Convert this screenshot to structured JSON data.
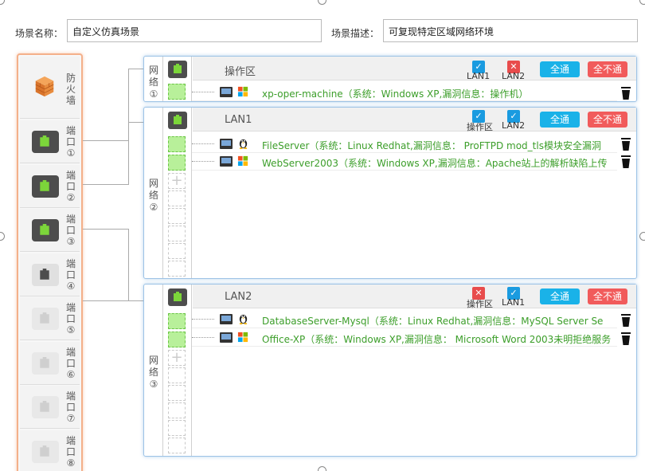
{
  "scene": {
    "name_label": "场景名称：",
    "name_value": "自定义仿真场景",
    "desc_label": "场景描述：",
    "desc_value": "可复现特定区域网络环境"
  },
  "firewall": {
    "label": "防火墙",
    "ports": [
      {
        "label": "端口①",
        "state": "active"
      },
      {
        "label": "端口②",
        "state": "active"
      },
      {
        "label": "端口③",
        "state": "active"
      },
      {
        "label": "端口④",
        "state": "idle"
      },
      {
        "label": "端口⑤",
        "state": "disabled"
      },
      {
        "label": "端口⑥",
        "state": "disabled"
      },
      {
        "label": "端口⑦",
        "state": "disabled"
      },
      {
        "label": "端口⑧",
        "state": "disabled"
      }
    ]
  },
  "networks": [
    {
      "label": "网络①",
      "title": "操作区",
      "checks": [
        {
          "label": "LAN1",
          "checked": true
        },
        {
          "label": "LAN2",
          "checked": false
        }
      ],
      "all_button": "全通",
      "none_button": "全不通",
      "hosts": [
        {
          "text": "xp-oper-machine（系统：Windows XP,漏洞信息：操作机）",
          "os": "windows-icon"
        }
      ]
    },
    {
      "label": "网络②",
      "title": "LAN1",
      "checks": [
        {
          "label": "操作区",
          "checked": true
        },
        {
          "label": "LAN2",
          "checked": true
        }
      ],
      "all_button": "全通",
      "none_button": "全不通",
      "hosts": [
        {
          "text": "FileServer（系统：Linux Redhat,漏洞信息： ProFTPD mod_tls模块安全漏洞",
          "os": "linux-icon"
        },
        {
          "text": "WebServer2003（系统：Windows XP,漏洞信息：Apache站上的解析缺陷上传",
          "os": "windows-icon"
        }
      ]
    },
    {
      "label": "网络③",
      "title": "LAN2",
      "checks": [
        {
          "label": "操作区",
          "checked": false
        },
        {
          "label": "LAN1",
          "checked": true
        }
      ],
      "all_button": "全通",
      "none_button": "全不通",
      "hosts": [
        {
          "text": "DatabaseServer-Mysql（系统：Linux Redhat,漏洞信息：MySQL Server Se",
          "os": "linux-icon"
        },
        {
          "text": "Office-XP（系统：Windows XP,漏洞信息： Microsoft Word 2003未明拒绝服务",
          "os": "windows-icon"
        }
      ]
    }
  ],
  "colors": {
    "accent_blue": "#1ab2e8",
    "danger_red": "#f15b5b",
    "host_text_green": "#3c9e2a",
    "panel_border": "#9dc3e6",
    "firewall_border": "#f4b08a"
  }
}
